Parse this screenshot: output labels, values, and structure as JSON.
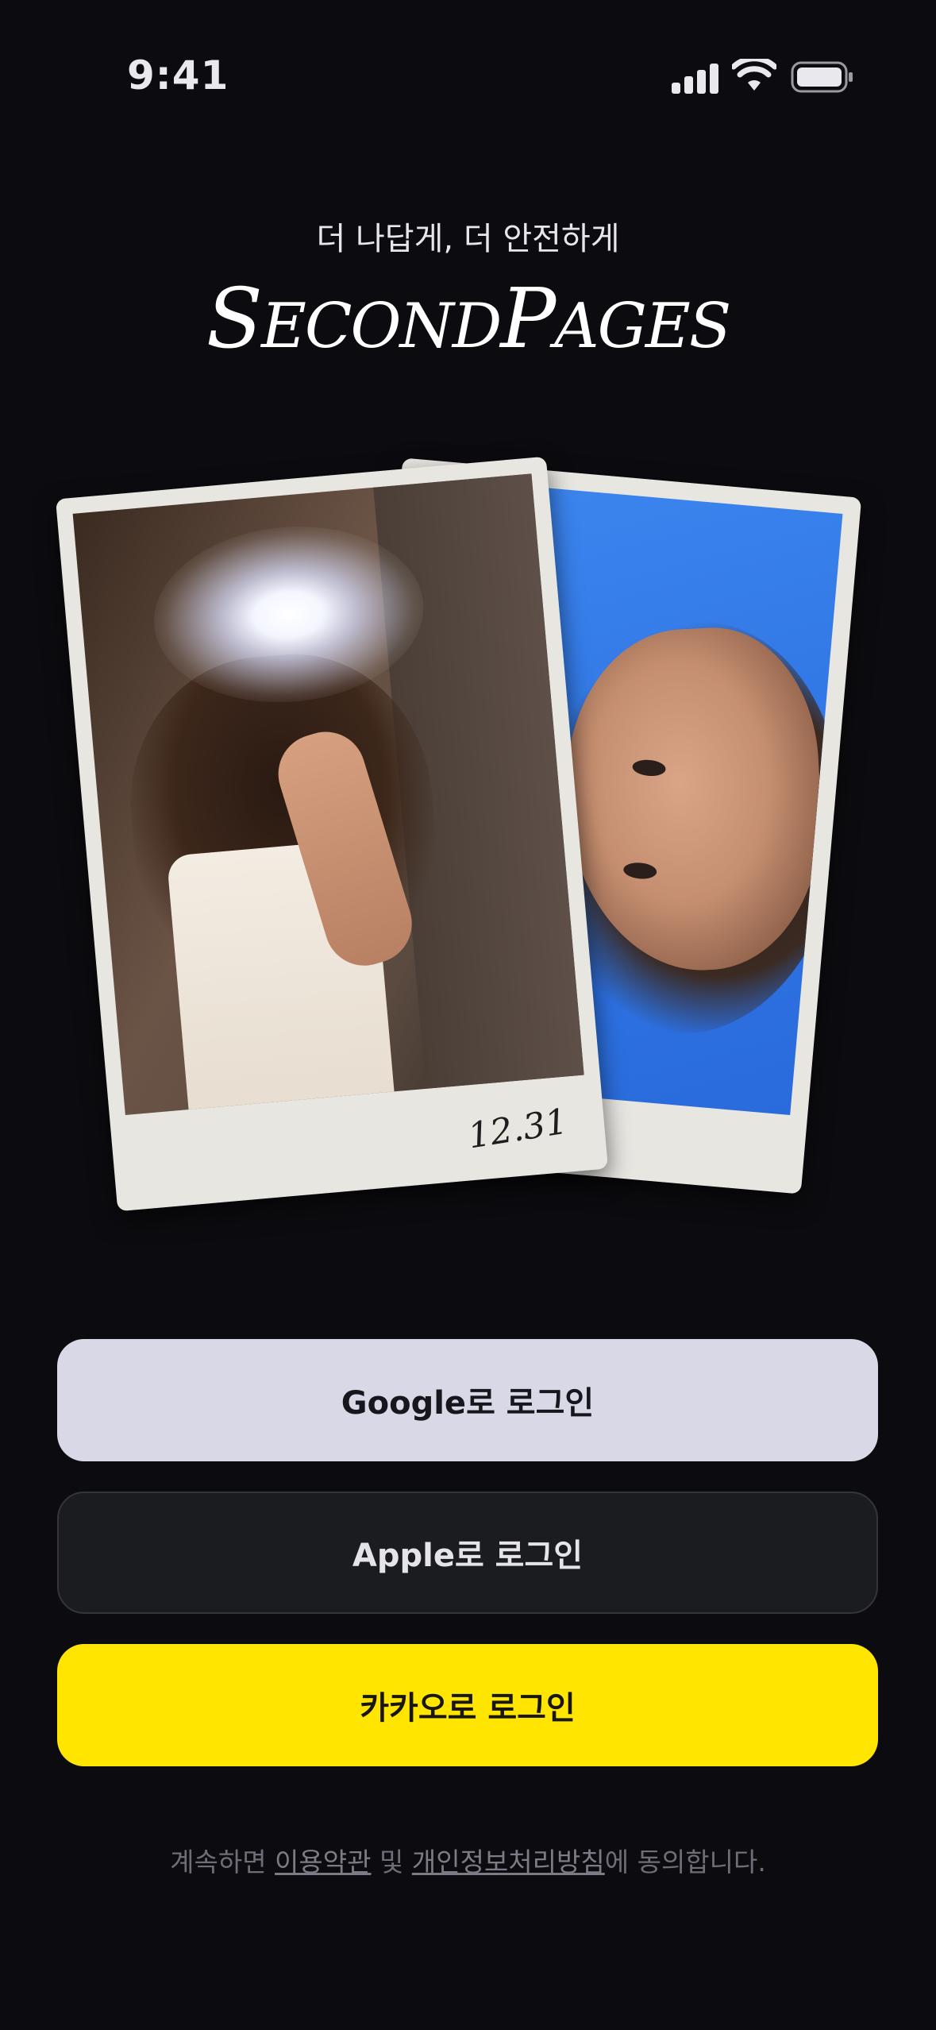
{
  "status_bar": {
    "time": "9:41"
  },
  "header": {
    "tagline": "더 나답게, 더 안전하게",
    "logo_text": "SecondPages",
    "logo_parts": [
      "S",
      "ECOND",
      "P",
      "AGES"
    ]
  },
  "polaroids": {
    "front_date": "12.31"
  },
  "buttons": {
    "google": "Google로 로그인",
    "apple": "Apple로 로그인",
    "kakao": "카카오로 로그인"
  },
  "footer": {
    "prefix": "계속하면 ",
    "terms": "이용약관",
    "and": " 및 ",
    "privacy": "개인정보처리방침",
    "suffix": "에 동의합니다."
  },
  "colors": {
    "background": "#0c0c10",
    "google_button": "#d8d8e6",
    "apple_button": "#1b1c20",
    "kakao_button": "#ffe500"
  }
}
